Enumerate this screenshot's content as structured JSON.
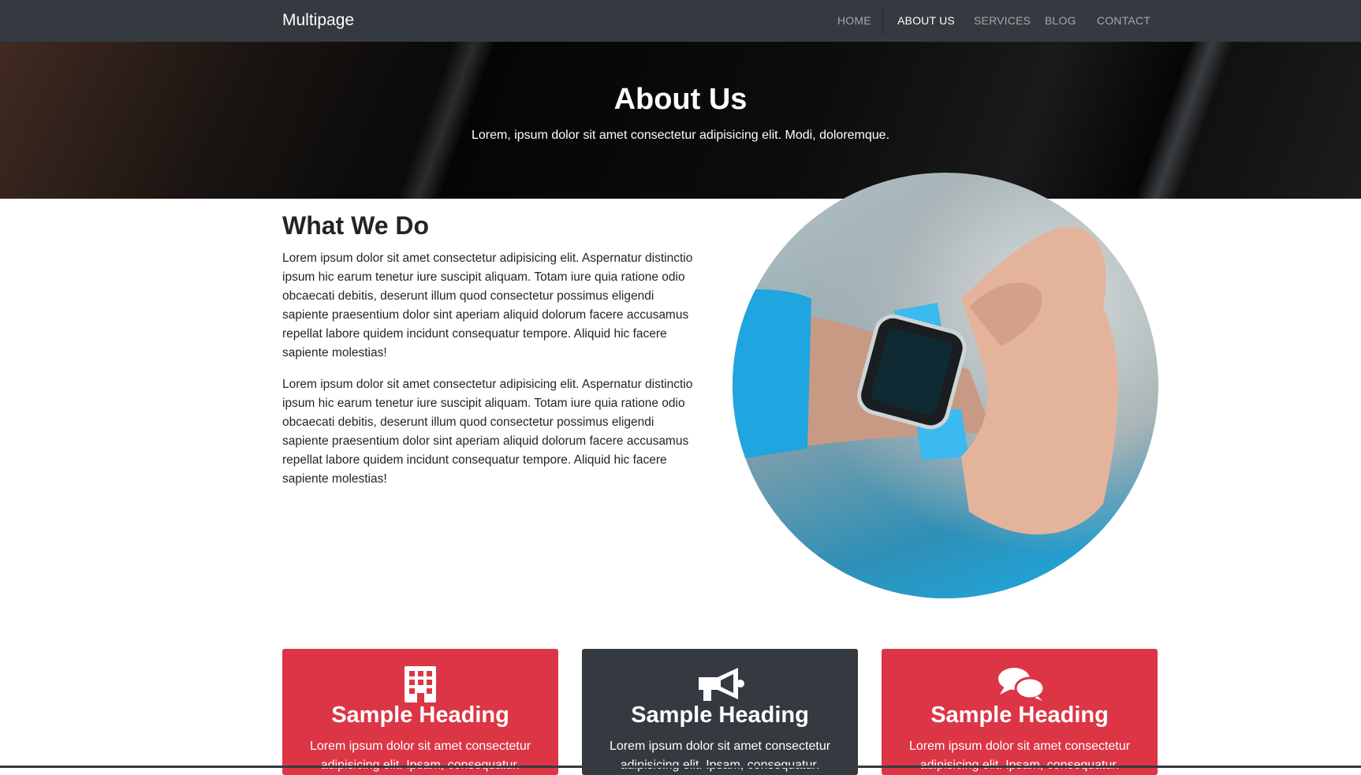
{
  "navbar": {
    "brand": "Multipage",
    "items": [
      {
        "label": "HOME",
        "active": false
      },
      {
        "label": "ABOUT US",
        "active": true
      },
      {
        "label": "SERVICES",
        "active": false
      },
      {
        "label": "BLOG",
        "active": false
      },
      {
        "label": "CONTACT",
        "active": false
      }
    ]
  },
  "hero": {
    "title": "About Us",
    "subtitle": "Lorem, ipsum dolor sit amet consectetur adipisicing elit. Modi, doloremque."
  },
  "what_we_do": {
    "title": "What We Do",
    "paragraphs": [
      "Lorem ipsum dolor sit amet consectetur adipisicing elit. Aspernatur distinctio ipsum hic earum tenetur iure suscipit aliquam. Totam iure quia ratione odio obcaecati debitis, deserunt illum quod consectetur possimus eligendi sapiente praesentium dolor sint aperiam aliquid dolorum facere accusamus repellat labore quidem incidunt consequatur tempore. Aliquid hic facere sapiente molestias!",
      "Lorem ipsum dolor sit amet consectetur adipisicing elit. Aspernatur distinctio ipsum hic earum tenetur iure suscipit aliquam. Totam iure quia ratione odio obcaecati debitis, deserunt illum quod consectetur possimus eligendi sapiente praesentium dolor sint aperiam aliquid dolorum facere accusamus repellat labore quidem incidunt consequatur tempore. Aliquid hic facere sapiente molestias!"
    ],
    "image_icon": "smartwatch-photo"
  },
  "cards": [
    {
      "icon": "building-icon",
      "color": "#dc3545",
      "heading": "Sample Heading",
      "text": "Lorem ipsum dolor sit amet consectetur adipisicing elit. Ipsam, consequatur."
    },
    {
      "icon": "bullhorn-icon",
      "color": "#343a40",
      "heading": "Sample Heading",
      "text": "Lorem ipsum dolor sit amet consectetur adipisicing elit. Ipsam, consequatur."
    },
    {
      "icon": "comments-icon",
      "color": "#dc3545",
      "heading": "Sample Heading",
      "text": "Lorem ipsum dolor sit amet consectetur adipisicing elit. Ipsam, consequatur."
    }
  ],
  "colors": {
    "navbar": "#343a40",
    "red": "#dc3545",
    "dark": "#343a40"
  }
}
